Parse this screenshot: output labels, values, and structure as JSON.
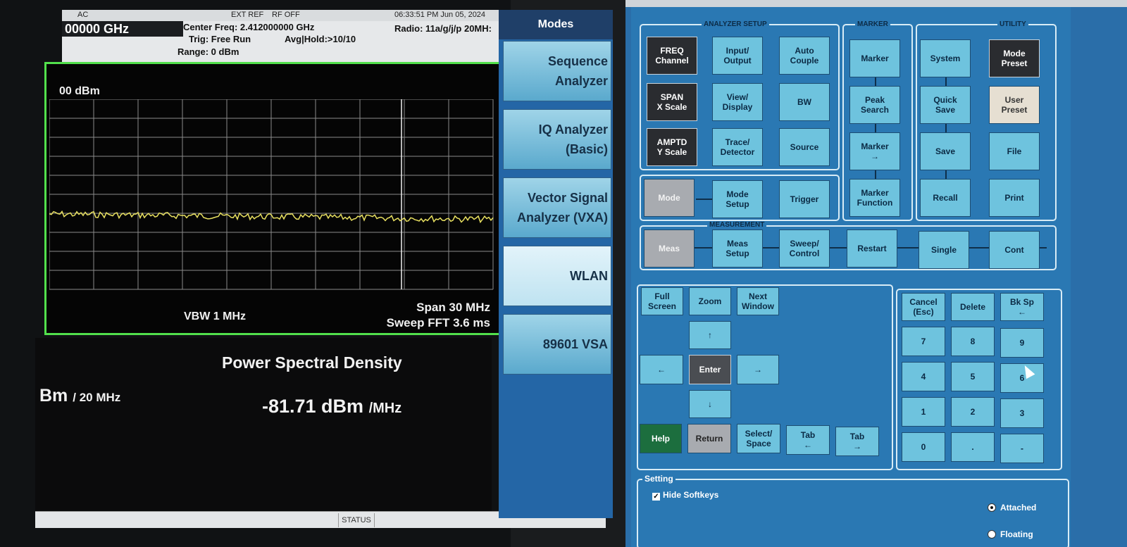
{
  "analyzer": {
    "status": {
      "coupling": "AC",
      "ext_ref": "EXT REF",
      "rf": "RF OFF",
      "datetime": "06:33:51 PM Jun 05, 2024"
    },
    "info": {
      "freq_display": "00000 GHz",
      "center_freq": "Center Freq: 2.412000000 GHz",
      "trig": "Trig: Free Run",
      "avg_hold": "Avg|Hold:>10/10",
      "range": "Range: 0 dBm",
      "radio": "Radio: 11a/g/j/p 20MH:"
    },
    "ref_level": "00 dBm",
    "vbw": "VBW  1 MHz",
    "span": "Span 30 MHz",
    "sweep": "Sweep FFT  3.6 ms",
    "result_title": "Power Spectral Density",
    "result_left_value": "Bm",
    "result_left_unit": "/ 20 MHz",
    "result_value": "-81.71 dBm",
    "result_unit": "/MHz",
    "status_label": "STATUS",
    "trace_color": "#e8e060",
    "frame_color": "#52e04c"
  },
  "modes": {
    "title": "Modes",
    "items": [
      {
        "label": "Sequence\nAnalyzer"
      },
      {
        "label": "IQ Analyzer\n(Basic)"
      },
      {
        "label": "Vector Signal\nAnalyzer (VXA)"
      },
      {
        "label": "WLAN"
      },
      {
        "label": "89601 VSA"
      }
    ],
    "selected": "WLAN"
  },
  "front_panel": {
    "group_labels": {
      "analyzer_setup": "ANALYZER SETUP",
      "marker": "MARKER",
      "utility": "UTILITY",
      "measurement": "MEASUREMENT"
    },
    "setup": {
      "freq": "FREQ\nChannel",
      "input": "Input/\nOutput",
      "auto": "Auto\nCouple",
      "span": "SPAN\nX Scale",
      "view": "View/\nDisplay",
      "bw": "BW",
      "amptd": "AMPTD\nY Scale",
      "trace": "Trace/\nDetector",
      "source": "Source",
      "mode": "Mode",
      "mode_setup": "Mode\nSetup",
      "trigger": "Trigger"
    },
    "marker": {
      "marker": "Marker",
      "peak": "Peak\nSearch",
      "marker_to": "Marker\n→",
      "marker_fn": "Marker\nFunction"
    },
    "utility": {
      "system": "System",
      "mode_preset": "Mode\nPreset",
      "quick_save": "Quick\nSave",
      "user_preset": "User\nPreset",
      "save": "Save",
      "file": "File",
      "recall": "Recall",
      "print": "Print"
    },
    "measurement": {
      "meas": "Meas",
      "meas_setup": "Meas\nSetup",
      "sweep": "Sweep/\nControl",
      "restart": "Restart",
      "single": "Single",
      "cont": "Cont"
    },
    "nav": {
      "full": "Full\nScreen",
      "zoom": "Zoom",
      "next": "Next\nWindow",
      "up": "↑",
      "left": "←",
      "enter": "Enter",
      "right": "→",
      "down": "↓",
      "help": "Help",
      "return": "Return",
      "select": "Select/\nSpace",
      "tab_back": "Tab\n←",
      "tab_fwd": "Tab\n→"
    },
    "keypad": {
      "cancel": "Cancel\n(Esc)",
      "delete": "Delete",
      "bksp": "Bk Sp\n←",
      "k7": "7",
      "k8": "8",
      "k9": "9",
      "k4": "4",
      "k5": "5",
      "k6": "6",
      "k1": "1",
      "k2": "2",
      "k3": "3",
      "k0": "0",
      "dot": ".",
      "minus": "-"
    },
    "setting": {
      "title": "Setting",
      "hide_softkeys": "Hide Softkeys",
      "hide_softkeys_checked": true,
      "attached": "Attached",
      "floating": "Floating",
      "dock": "Attached"
    }
  }
}
